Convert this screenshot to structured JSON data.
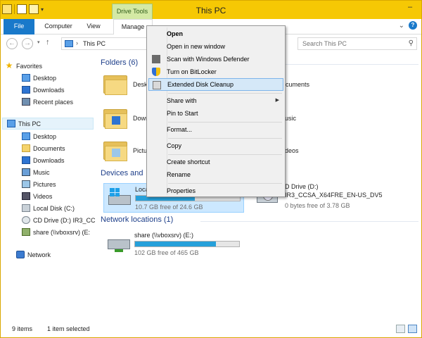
{
  "titlebar": {
    "title": "This PC",
    "contextual_tab": "Drive Tools",
    "minimize_glyph": "–"
  },
  "ribbon": {
    "tabs": [
      {
        "label": "File"
      },
      {
        "label": "Computer"
      },
      {
        "label": "View"
      },
      {
        "label": "Manage"
      }
    ],
    "collapse_glyph": "⌄",
    "help_glyph": "?"
  },
  "address": {
    "back_glyph": "←",
    "forward_glyph": "→",
    "recent_glyph": "▾",
    "up_glyph": "↑",
    "path": "This PC",
    "path_separator": "›",
    "search_placeholder": "Search This PC"
  },
  "navpane": {
    "favorites": {
      "label": "Favorites",
      "items": [
        "Desktop",
        "Downloads",
        "Recent places"
      ]
    },
    "thispc": {
      "label": "This PC",
      "items": [
        "Desktop",
        "Documents",
        "Downloads",
        "Music",
        "Pictures",
        "Videos",
        "Local Disk (C:)",
        "CD Drive (D:) IR3_CC",
        "share (\\\\vboxsrv) (E:"
      ]
    },
    "network": {
      "label": "Network"
    }
  },
  "content": {
    "folders_header": "Folders (6)",
    "folders": [
      {
        "label": "Deskt"
      },
      {
        "label": "ocuments"
      },
      {
        "label": "Down"
      },
      {
        "label": "usic"
      },
      {
        "label": "Pictu"
      },
      {
        "label": "deos"
      }
    ],
    "devices_header": "Devices and",
    "drive_c": {
      "name": "Loca",
      "free": "10.7 GB free of 24.6 GB",
      "used_fraction": 0.57
    },
    "drive_d": {
      "name": "D Drive (D:)",
      "label2": "IR3_CCSA_X64FRE_EN-US_DV5",
      "free": "0 bytes free of 3.78 GB"
    },
    "network_header": "Network locations (1)",
    "share": {
      "name": "share (\\\\vboxsrv) (E:)",
      "free": "102 GB free of 465 GB",
      "used_fraction": 0.78
    }
  },
  "context_menu": {
    "items": {
      "open": "Open",
      "open_new_window": "Open in new window",
      "scan_defender": "Scan with Windows Defender",
      "bitlocker": "Turn on BitLocker",
      "disk_cleanup": "Extended Disk Cleanup",
      "share_with": "Share with",
      "pin_to_start": "Pin to Start",
      "format": "Format...",
      "copy": "Copy",
      "create_shortcut": "Create shortcut",
      "rename": "Rename",
      "properties": "Properties"
    },
    "submenu_glyph": "▶"
  },
  "statusbar": {
    "item_count": "9 items",
    "selected": "1 item selected"
  },
  "colors": {
    "titlebar": "#f6c804",
    "file_tab": "#1979ca",
    "drive_tools_tab": "#d4e9a4",
    "selection": "#cce8ff",
    "progress": "#26a0da",
    "group_header": "#1e3f8a"
  }
}
